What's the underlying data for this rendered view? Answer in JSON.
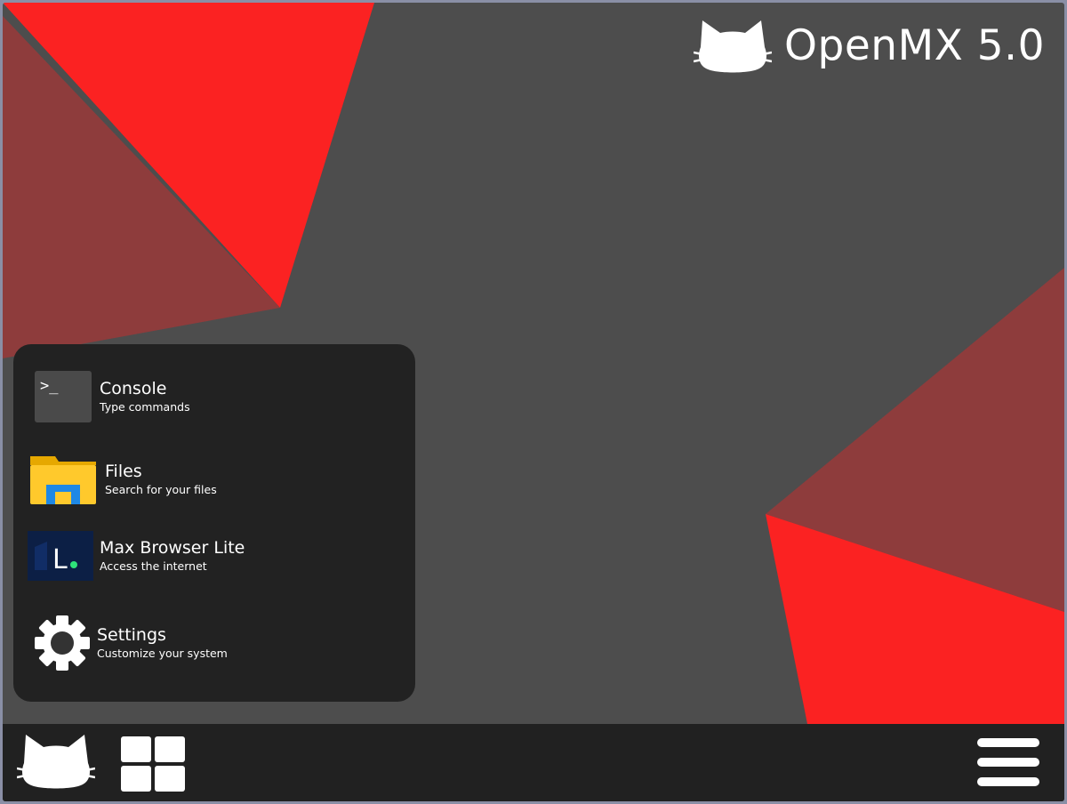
{
  "os": {
    "name": "OpenMX 5.0",
    "logo_icon": "cat-head-icon"
  },
  "colors": {
    "desktop_bg": "#4d4d4d",
    "accent_red": "#fb2222",
    "muted_red": "#8e3c3c",
    "panel_bg": "#222222",
    "taskbar_bg": "#212121"
  },
  "start_menu": {
    "items": [
      {
        "title": "Console",
        "subtitle": "Type commands",
        "icon": "terminal-icon"
      },
      {
        "title": "Files",
        "subtitle": "Search for your files",
        "icon": "folder-icon"
      },
      {
        "title": "Max Browser Lite",
        "subtitle": "Access the internet",
        "icon": "browser-icon"
      },
      {
        "title": "Settings",
        "subtitle": "Customize your system",
        "icon": "gear-icon"
      }
    ]
  },
  "taskbar": {
    "start_icon": "cat-head-icon",
    "apps_icon": "grid-icon",
    "menu_icon": "hamburger-icon"
  }
}
